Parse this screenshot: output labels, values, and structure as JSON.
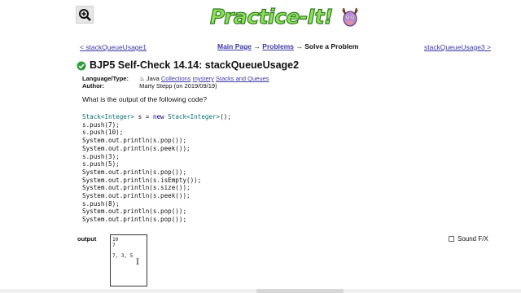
{
  "logo": {
    "text": "Practice-It!",
    "icon": "moose-mascot"
  },
  "toolbar": {
    "zoom_icon": "zoom-in-icon"
  },
  "nav": {
    "prev_label": "< stackQueueUsage1",
    "main_page": "Main Page",
    "arrow1": " → ",
    "problems": "Problems",
    "arrow2": " → ",
    "current": "Solve a Problem",
    "next_label": "stackQueueUsage3 >"
  },
  "problem": {
    "status_icon": "check-circle-icon",
    "title": "BJP5 Self-Check 14.14: stackQueueUsage2",
    "language_label": "Language/Type:",
    "language_icon": "java-icon",
    "language": "Java",
    "tags": [
      "Collections",
      "mystery",
      "Stacks and Queues"
    ],
    "author_label": "Author:",
    "author": "Marty Stepp (on 2019/09/19)",
    "question": "What is the output of the following code?",
    "code_lines": [
      "Stack<Integer> s = new Stack<Integer>();",
      "s.push(7);",
      "s.push(10);",
      "System.out.println(s.pop());",
      "System.out.println(s.peek());",
      "s.push(3);",
      "s.push(5);",
      "System.out.println(s.pop());",
      "System.out.println(s.isEmpty());",
      "System.out.println(s.size());",
      "System.out.println(s.peek());",
      "s.push(8);",
      "System.out.println(s.pop());",
      "System.out.println(s.pop());"
    ]
  },
  "answer": {
    "label": "output",
    "value": "10\n7\n\n7, 3, 5"
  },
  "sound": {
    "label": "Sound F/X",
    "checked": false
  },
  "colors": {
    "link": "#3a3aa8",
    "logo_fill": "#8ee05a",
    "logo_stroke": "#2f7d1e",
    "check": "#2e9e3a"
  }
}
